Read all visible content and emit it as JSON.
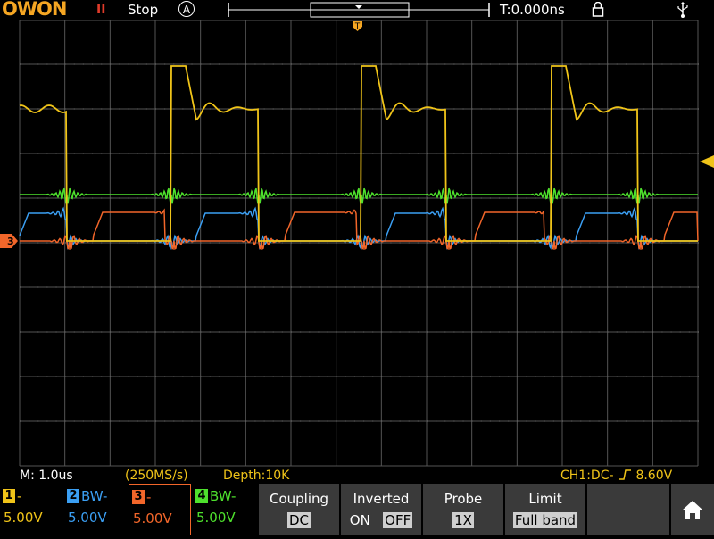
{
  "topbar": {
    "brand": "OWON",
    "run_indicator": "II",
    "run_state": "Stop",
    "trigger_mode_badge": "A",
    "time_offset": "T:0.000ns",
    "icons": [
      "lock-icon",
      "usb-icon"
    ]
  },
  "status": {
    "timebase": "M: 1.0us",
    "sample_rate": "(250MS/s)",
    "depth": "Depth:10K",
    "trigger": "CH1:DC-",
    "trigger_level": "8.60V"
  },
  "channels": [
    {
      "num": "1",
      "bw": "-",
      "volts": "5.00V",
      "color": "#f0c419"
    },
    {
      "num": "2",
      "bw": "BW-",
      "volts": "5.00V",
      "color": "#3b9ff3"
    },
    {
      "num": "3",
      "bw": "-",
      "volts": "5.00V",
      "color": "#f2662a"
    },
    {
      "num": "4",
      "bw": "BW-",
      "volts": "5.00V",
      "color": "#4ee12d"
    }
  ],
  "menu": {
    "coupling": {
      "label": "Coupling",
      "value": "DC"
    },
    "inverted": {
      "label": "Inverted",
      "on": "ON",
      "off": "OFF"
    },
    "probe": {
      "label": "Probe",
      "value": "1X"
    },
    "limit": {
      "label": "Limit",
      "value": "Full band"
    }
  },
  "markers": {
    "trigger_pos": "T",
    "ch3_ground": "3"
  },
  "colors": {
    "grid": "#555555",
    "brand": "#f5a623",
    "trigger": "#f0c419",
    "softkey_bg": "#3a3a3a"
  }
}
